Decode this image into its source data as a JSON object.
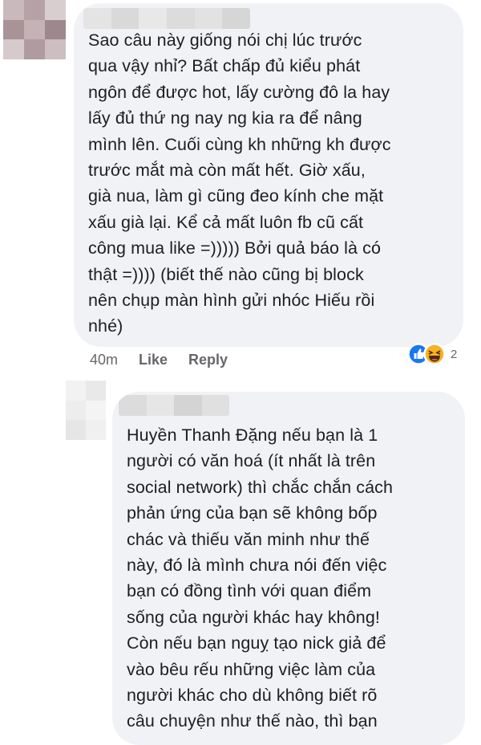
{
  "comment1": {
    "avatar_name": "avatar-blurred",
    "text": "Sao câu này giống nói chị lúc trước\nqua vậy nhỉ? Bất chấp đủ kiểu phát\nngôn để được hot, lấy cường đô la hay\nlấy đủ thứ ng nay ng kia ra để nâng\nmình lên. Cuối cùng kh những kh được\ntrước mắt mà còn mất hết. Giờ xấu,\ngià nua, làm gì cũng đeo kính che mặt\nxấu già lại. Kể cả mất luôn fb cũ cất\ncông mua like =))))) Bởi quả báo là có\nthật =)))) (biết thế nào cũng bị block\nnên chụp màn hình gửi nhóc Hiếu rồi\nnhé)",
    "time": "40m",
    "like_label": "Like",
    "reply_label": "Reply",
    "reaction_icons": [
      "like-reaction-icon",
      "haha-reaction-icon"
    ],
    "reaction_count": "2"
  },
  "comment2": {
    "text": "Huyền Thanh Đặng nếu bạn là 1\nngười có văn hoá (ít nhất là trên\nsocial network) thì chắc chắn cách\nphản ứng của bạn sẽ không bốp\nchác và thiếu văn minh như thế\nnày, đó là mình chưa nói đến việc\nbạn có đồng tình với quan điểm\nsống của người khác hay không!\nCòn nếu bạn nguỵ tạo nick giả để\nvào bêu rếu những việc làm của\nngười khác cho dù không biết rõ\ncâu chuyện như thế nào, thì bạn"
  },
  "colors": {
    "bubble": "#f0f2f5",
    "text": "#1c1e21",
    "meta": "#65676b",
    "like_blue": "#1877f2",
    "haha_yellow": "#f7b125"
  }
}
